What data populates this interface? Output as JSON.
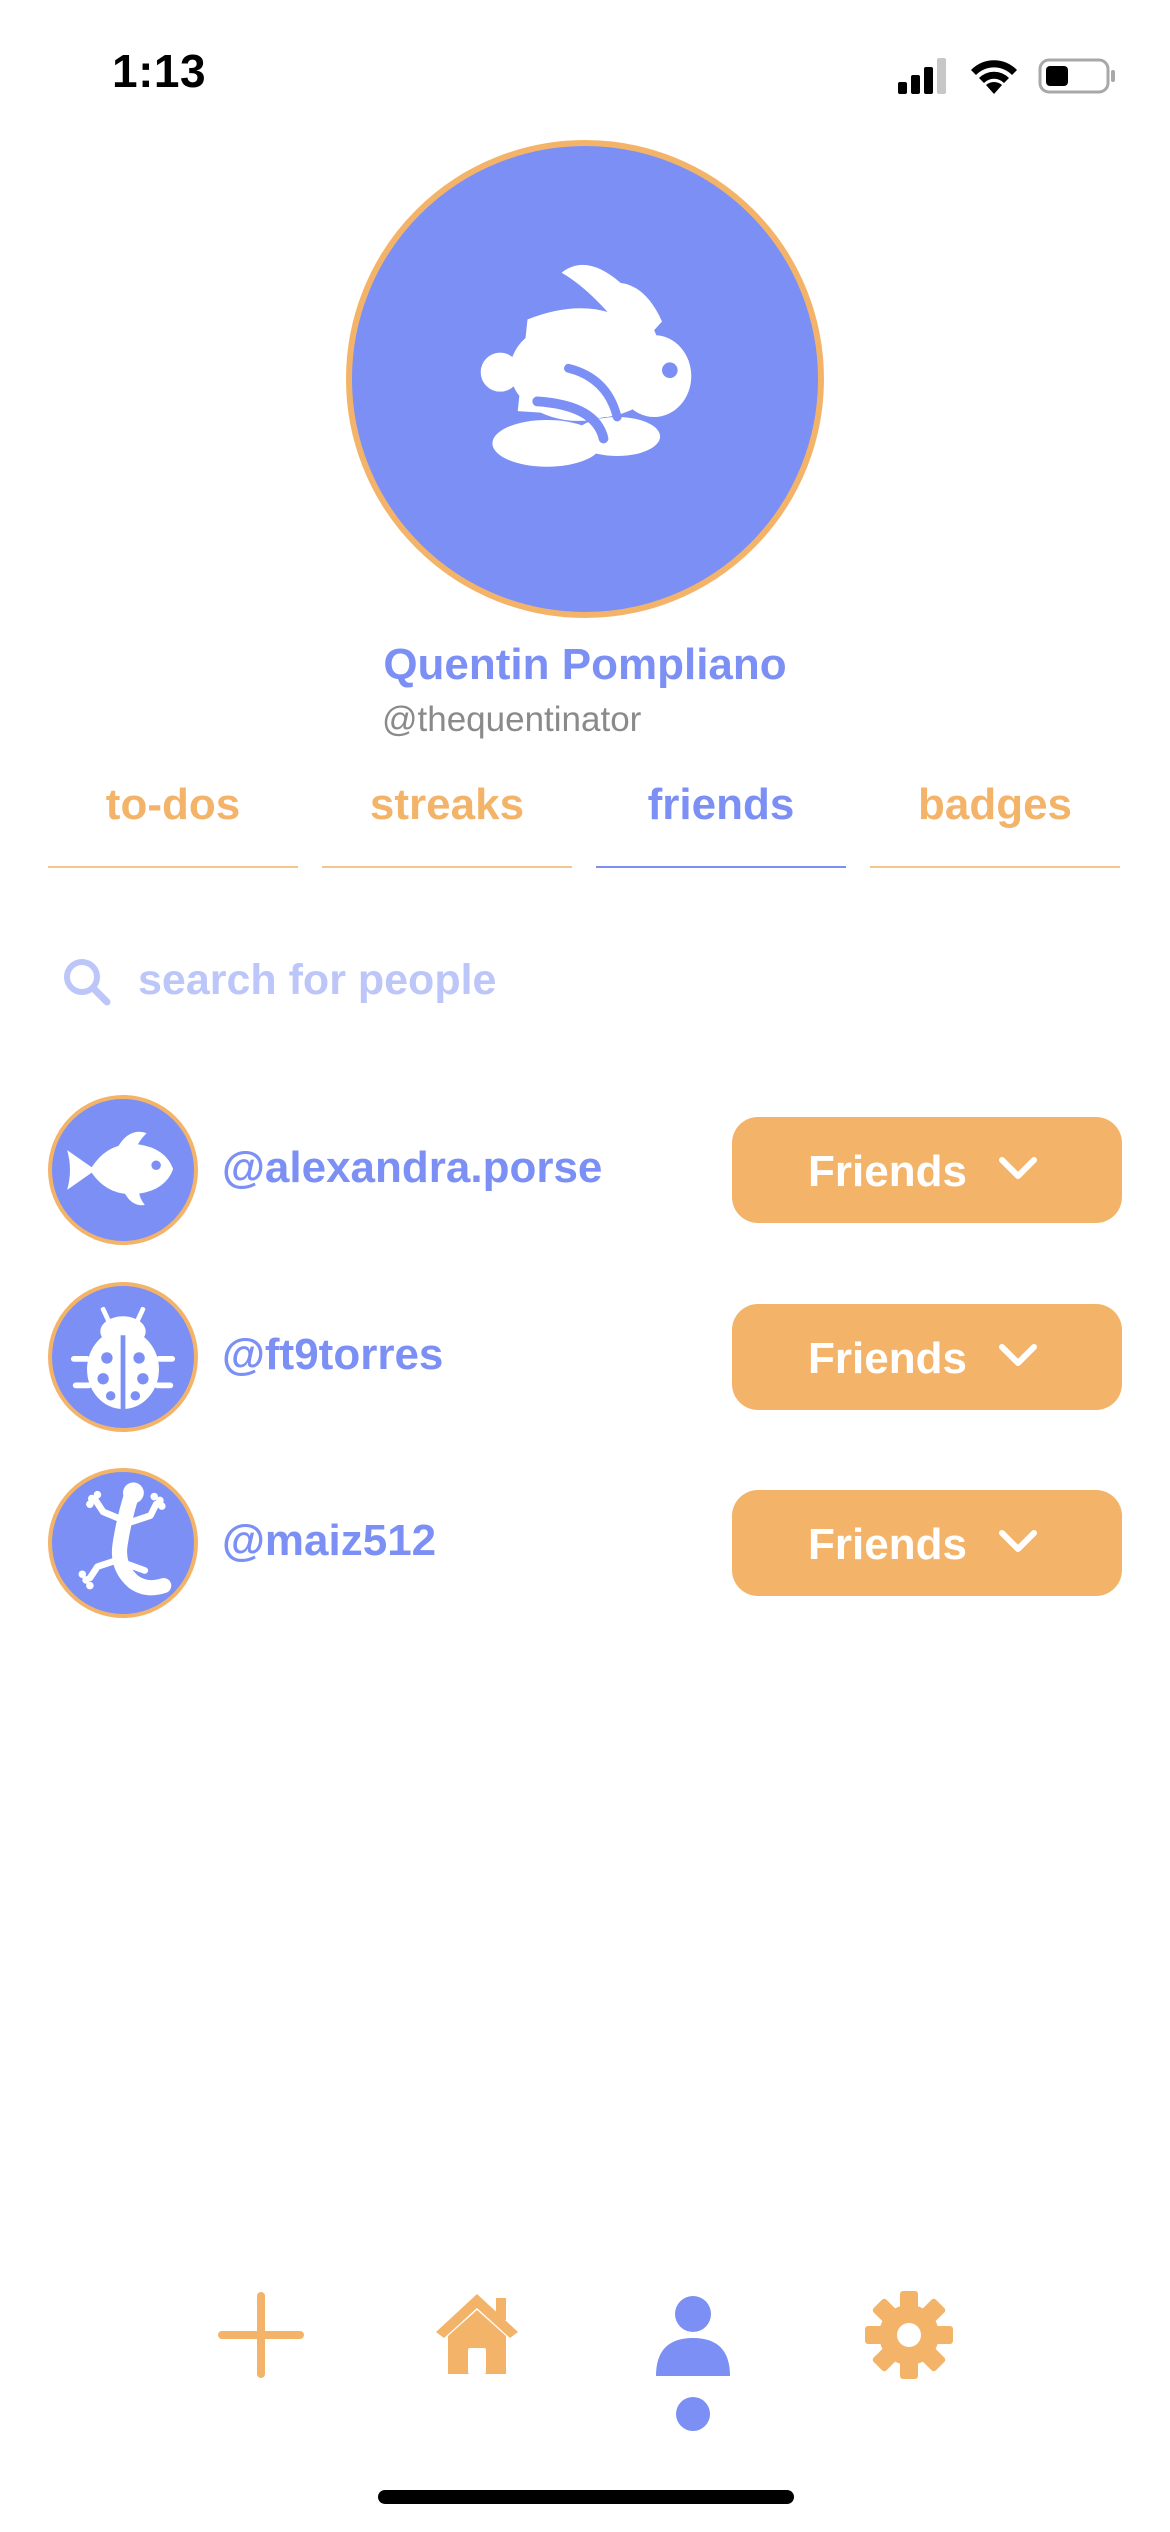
{
  "status_bar": {
    "time": "1:13"
  },
  "profile": {
    "name": "Quentin Pompliano",
    "handle": "@thequentinator",
    "avatar_icon": "rabbit-icon"
  },
  "tabs": [
    {
      "label": "to-dos",
      "active": false
    },
    {
      "label": "streaks",
      "active": false
    },
    {
      "label": "friends",
      "active": true
    },
    {
      "label": "badges",
      "active": false
    }
  ],
  "search": {
    "placeholder": "search for people",
    "value": ""
  },
  "friends": [
    {
      "handle": "@alexandra.porse",
      "avatar_icon": "fish-icon",
      "button_label": "Friends"
    },
    {
      "handle": "@ft9torres",
      "avatar_icon": "ladybug-icon",
      "button_label": "Friends"
    },
    {
      "handle": "@maiz512",
      "avatar_icon": "lizard-icon",
      "button_label": "Friends"
    }
  ],
  "bottom_nav": [
    {
      "icon": "plus-icon",
      "active": false
    },
    {
      "icon": "home-icon",
      "active": false
    },
    {
      "icon": "profile-icon",
      "active": true
    },
    {
      "icon": "gear-icon",
      "active": false
    }
  ],
  "colors": {
    "accent_blue": "#7b8ff5",
    "accent_orange": "#f3b46a",
    "muted_text": "#8a8a8a"
  }
}
